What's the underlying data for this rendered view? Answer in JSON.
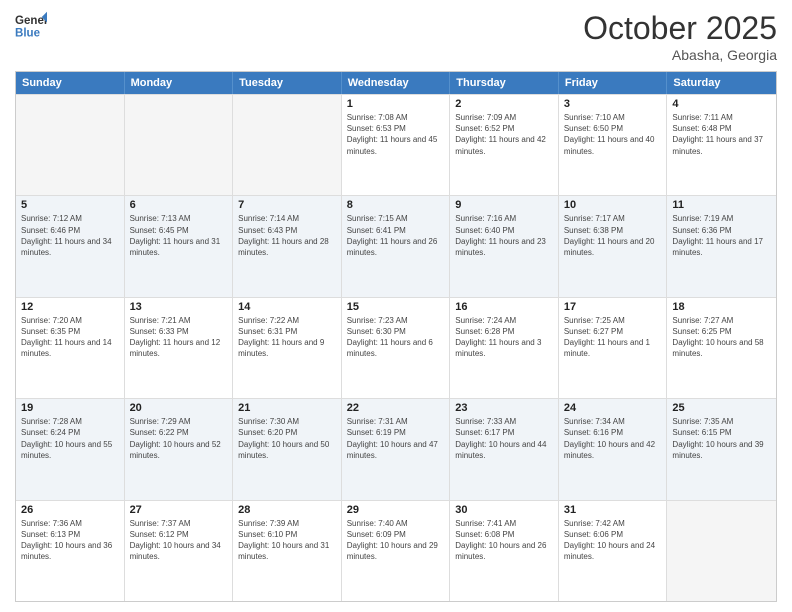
{
  "header": {
    "logo_general": "General",
    "logo_blue": "Blue",
    "month_title": "October 2025",
    "subtitle": "Abasha, Georgia"
  },
  "weekdays": [
    "Sunday",
    "Monday",
    "Tuesday",
    "Wednesday",
    "Thursday",
    "Friday",
    "Saturday"
  ],
  "rows": [
    [
      {
        "day": "",
        "sunrise": "",
        "sunset": "",
        "daylight": "",
        "empty": true
      },
      {
        "day": "",
        "sunrise": "",
        "sunset": "",
        "daylight": "",
        "empty": true
      },
      {
        "day": "",
        "sunrise": "",
        "sunset": "",
        "daylight": "",
        "empty": true
      },
      {
        "day": "1",
        "sunrise": "Sunrise: 7:08 AM",
        "sunset": "Sunset: 6:53 PM",
        "daylight": "Daylight: 11 hours and 45 minutes."
      },
      {
        "day": "2",
        "sunrise": "Sunrise: 7:09 AM",
        "sunset": "Sunset: 6:52 PM",
        "daylight": "Daylight: 11 hours and 42 minutes."
      },
      {
        "day": "3",
        "sunrise": "Sunrise: 7:10 AM",
        "sunset": "Sunset: 6:50 PM",
        "daylight": "Daylight: 11 hours and 40 minutes."
      },
      {
        "day": "4",
        "sunrise": "Sunrise: 7:11 AM",
        "sunset": "Sunset: 6:48 PM",
        "daylight": "Daylight: 11 hours and 37 minutes."
      }
    ],
    [
      {
        "day": "5",
        "sunrise": "Sunrise: 7:12 AM",
        "sunset": "Sunset: 6:46 PM",
        "daylight": "Daylight: 11 hours and 34 minutes."
      },
      {
        "day": "6",
        "sunrise": "Sunrise: 7:13 AM",
        "sunset": "Sunset: 6:45 PM",
        "daylight": "Daylight: 11 hours and 31 minutes."
      },
      {
        "day": "7",
        "sunrise": "Sunrise: 7:14 AM",
        "sunset": "Sunset: 6:43 PM",
        "daylight": "Daylight: 11 hours and 28 minutes."
      },
      {
        "day": "8",
        "sunrise": "Sunrise: 7:15 AM",
        "sunset": "Sunset: 6:41 PM",
        "daylight": "Daylight: 11 hours and 26 minutes."
      },
      {
        "day": "9",
        "sunrise": "Sunrise: 7:16 AM",
        "sunset": "Sunset: 6:40 PM",
        "daylight": "Daylight: 11 hours and 23 minutes."
      },
      {
        "day": "10",
        "sunrise": "Sunrise: 7:17 AM",
        "sunset": "Sunset: 6:38 PM",
        "daylight": "Daylight: 11 hours and 20 minutes."
      },
      {
        "day": "11",
        "sunrise": "Sunrise: 7:19 AM",
        "sunset": "Sunset: 6:36 PM",
        "daylight": "Daylight: 11 hours and 17 minutes."
      }
    ],
    [
      {
        "day": "12",
        "sunrise": "Sunrise: 7:20 AM",
        "sunset": "Sunset: 6:35 PM",
        "daylight": "Daylight: 11 hours and 14 minutes."
      },
      {
        "day": "13",
        "sunrise": "Sunrise: 7:21 AM",
        "sunset": "Sunset: 6:33 PM",
        "daylight": "Daylight: 11 hours and 12 minutes."
      },
      {
        "day": "14",
        "sunrise": "Sunrise: 7:22 AM",
        "sunset": "Sunset: 6:31 PM",
        "daylight": "Daylight: 11 hours and 9 minutes."
      },
      {
        "day": "15",
        "sunrise": "Sunrise: 7:23 AM",
        "sunset": "Sunset: 6:30 PM",
        "daylight": "Daylight: 11 hours and 6 minutes."
      },
      {
        "day": "16",
        "sunrise": "Sunrise: 7:24 AM",
        "sunset": "Sunset: 6:28 PM",
        "daylight": "Daylight: 11 hours and 3 minutes."
      },
      {
        "day": "17",
        "sunrise": "Sunrise: 7:25 AM",
        "sunset": "Sunset: 6:27 PM",
        "daylight": "Daylight: 11 hours and 1 minute."
      },
      {
        "day": "18",
        "sunrise": "Sunrise: 7:27 AM",
        "sunset": "Sunset: 6:25 PM",
        "daylight": "Daylight: 10 hours and 58 minutes."
      }
    ],
    [
      {
        "day": "19",
        "sunrise": "Sunrise: 7:28 AM",
        "sunset": "Sunset: 6:24 PM",
        "daylight": "Daylight: 10 hours and 55 minutes."
      },
      {
        "day": "20",
        "sunrise": "Sunrise: 7:29 AM",
        "sunset": "Sunset: 6:22 PM",
        "daylight": "Daylight: 10 hours and 52 minutes."
      },
      {
        "day": "21",
        "sunrise": "Sunrise: 7:30 AM",
        "sunset": "Sunset: 6:20 PM",
        "daylight": "Daylight: 10 hours and 50 minutes."
      },
      {
        "day": "22",
        "sunrise": "Sunrise: 7:31 AM",
        "sunset": "Sunset: 6:19 PM",
        "daylight": "Daylight: 10 hours and 47 minutes."
      },
      {
        "day": "23",
        "sunrise": "Sunrise: 7:33 AM",
        "sunset": "Sunset: 6:17 PM",
        "daylight": "Daylight: 10 hours and 44 minutes."
      },
      {
        "day": "24",
        "sunrise": "Sunrise: 7:34 AM",
        "sunset": "Sunset: 6:16 PM",
        "daylight": "Daylight: 10 hours and 42 minutes."
      },
      {
        "day": "25",
        "sunrise": "Sunrise: 7:35 AM",
        "sunset": "Sunset: 6:15 PM",
        "daylight": "Daylight: 10 hours and 39 minutes."
      }
    ],
    [
      {
        "day": "26",
        "sunrise": "Sunrise: 7:36 AM",
        "sunset": "Sunset: 6:13 PM",
        "daylight": "Daylight: 10 hours and 36 minutes."
      },
      {
        "day": "27",
        "sunrise": "Sunrise: 7:37 AM",
        "sunset": "Sunset: 6:12 PM",
        "daylight": "Daylight: 10 hours and 34 minutes."
      },
      {
        "day": "28",
        "sunrise": "Sunrise: 7:39 AM",
        "sunset": "Sunset: 6:10 PM",
        "daylight": "Daylight: 10 hours and 31 minutes."
      },
      {
        "day": "29",
        "sunrise": "Sunrise: 7:40 AM",
        "sunset": "Sunset: 6:09 PM",
        "daylight": "Daylight: 10 hours and 29 minutes."
      },
      {
        "day": "30",
        "sunrise": "Sunrise: 7:41 AM",
        "sunset": "Sunset: 6:08 PM",
        "daylight": "Daylight: 10 hours and 26 minutes."
      },
      {
        "day": "31",
        "sunrise": "Sunrise: 7:42 AM",
        "sunset": "Sunset: 6:06 PM",
        "daylight": "Daylight: 10 hours and 24 minutes."
      },
      {
        "day": "",
        "sunrise": "",
        "sunset": "",
        "daylight": "",
        "empty": true
      }
    ]
  ]
}
